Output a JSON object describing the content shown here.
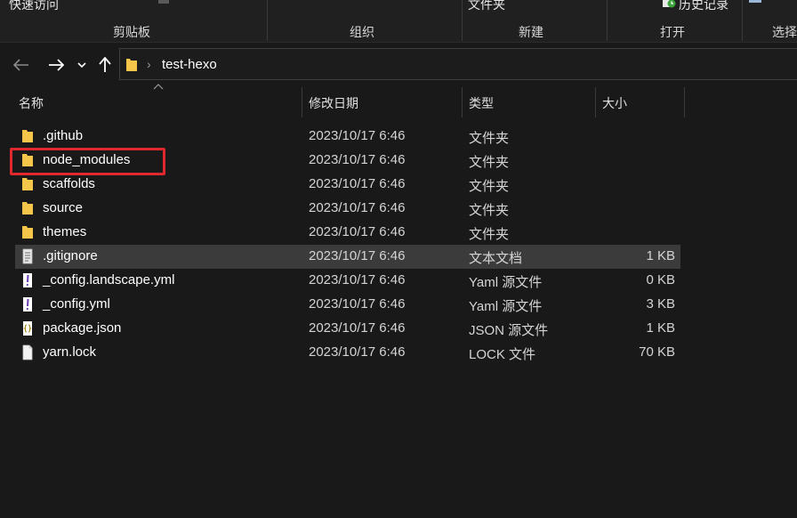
{
  "ribbon": {
    "quick_access": "快速访问",
    "folder_label": "文件夹",
    "history": "历史记录",
    "groups": {
      "clipboard": "剪贴板",
      "organize": "组织",
      "new": "新建",
      "open": "打开",
      "select": "选择"
    }
  },
  "address": {
    "breadcrumb": "test-hexo"
  },
  "columns": {
    "name": "名称",
    "modified": "修改日期",
    "type": "类型",
    "size": "大小"
  },
  "files": [
    {
      "name": ".github",
      "date": "2023/10/17 6:46",
      "type": "文件夹",
      "size": "",
      "icon": "folder-icon"
    },
    {
      "name": "node_modules",
      "date": "2023/10/17 6:46",
      "type": "文件夹",
      "size": "",
      "icon": "folder-icon"
    },
    {
      "name": "scaffolds",
      "date": "2023/10/17 6:46",
      "type": "文件夹",
      "size": "",
      "icon": "folder-icon"
    },
    {
      "name": "source",
      "date": "2023/10/17 6:46",
      "type": "文件夹",
      "size": "",
      "icon": "folder-icon"
    },
    {
      "name": "themes",
      "date": "2023/10/17 6:46",
      "type": "文件夹",
      "size": "",
      "icon": "folder-icon"
    },
    {
      "name": ".gitignore",
      "date": "2023/10/17 6:46",
      "type": "文本文档",
      "size": "1 KB",
      "icon": "text-file-icon"
    },
    {
      "name": "_config.landscape.yml",
      "date": "2023/10/17 6:46",
      "type": "Yaml 源文件",
      "size": "0 KB",
      "icon": "yaml-file-icon"
    },
    {
      "name": "_config.yml",
      "date": "2023/10/17 6:46",
      "type": "Yaml 源文件",
      "size": "3 KB",
      "icon": "yaml-file-icon"
    },
    {
      "name": "package.json",
      "date": "2023/10/17 6:46",
      "type": "JSON 源文件",
      "size": "1 KB",
      "icon": "json-file-icon"
    },
    {
      "name": "yarn.lock",
      "date": "2023/10/17 6:46",
      "type": "LOCK 文件",
      "size": "70 KB",
      "icon": "blank-file-icon"
    }
  ],
  "colors": {
    "background": "#191919",
    "selected_row": "#3b3b3b",
    "highlight": "#e0282e",
    "folder": "#f5c64a"
  }
}
